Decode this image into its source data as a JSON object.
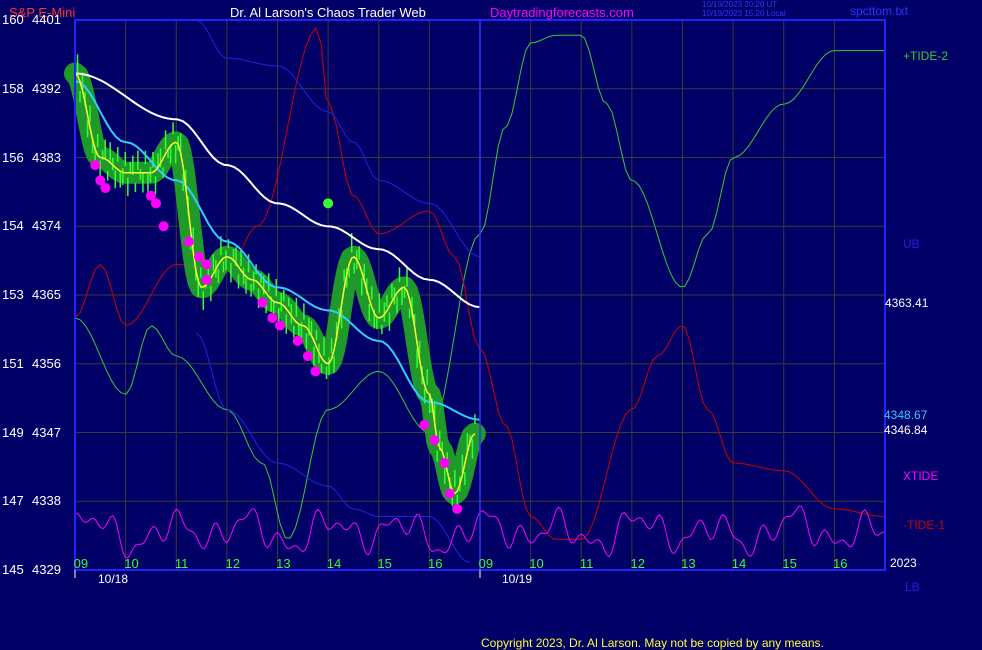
{
  "header": {
    "instrument": "S&P E-Mini",
    "title": "Dr. Al Larson's Chaos Trader Web",
    "site": "Daytradingforecasts.com",
    "stamp_ut": "10/19/2023 20:20 UT",
    "stamp_local": "10/19/2023 15:20 Local",
    "filename": "spcttom.txt"
  },
  "colors": {
    "background": "#000066",
    "grid": "#3a3a3a",
    "frame": "#2222ff",
    "price": "#ffff33",
    "price_bar": "#33ff33",
    "halo": "#22aa22",
    "dot": "#ff00ff",
    "ma_long": "#ffffff",
    "ma_short": "#33ccff",
    "upper_band": "#2222dd",
    "tide_2": "#33cc33",
    "tide_1": "#cc0000",
    "xtide": "#ff00ff",
    "forecast_line": "#3333ff",
    "left_label_text": "#ffffff",
    "hour_label": "#33ff33",
    "copyright_text": "#ffff33"
  },
  "left_axis": [
    {
      "deg": "160",
      "price": "4401"
    },
    {
      "deg": "158",
      "price": "4392"
    },
    {
      "deg": "156",
      "price": "4383"
    },
    {
      "deg": "154",
      "price": "4374"
    },
    {
      "deg": "153",
      "price": "4365"
    },
    {
      "deg": "151",
      "price": "4356"
    },
    {
      "deg": "149",
      "price": "4347"
    },
    {
      "deg": "147",
      "price": "4338"
    },
    {
      "deg": "145",
      "price": "4329"
    }
  ],
  "hour_labels": [
    "09",
    "10",
    "11",
    "12",
    "13",
    "14",
    "15",
    "16",
    "09",
    "10",
    "11",
    "12",
    "13",
    "14",
    "15",
    "16"
  ],
  "date_labels": [
    "10/18",
    "10/19"
  ],
  "year_label": "2023",
  "right_labels": {
    "tide_2": "+TIDE-2",
    "ub": "UB",
    "last_ma_long": "4363.41",
    "last_ma_short": "4348.67",
    "last_price": "4346.84",
    "xtide": "XTIDE",
    "tide_1": "-TIDE-1",
    "lb": "LB"
  },
  "copyright": "Copyright 2023, Dr. Al Larson. May not be copied by any means.",
  "chart_data": {
    "type": "line",
    "title": "S&P E-Mini",
    "y_price_range": [
      4329,
      4401
    ],
    "x_days": [
      "10/18",
      "10/19"
    ],
    "session_hours": [
      "09",
      "10",
      "11",
      "12",
      "13",
      "14",
      "15",
      "16"
    ],
    "series": [
      {
        "name": "price",
        "x": [
          0,
          0.5,
          1,
          1.5,
          2,
          2.5,
          3,
          3.5,
          4,
          4.5,
          5,
          5.5,
          6,
          6.5,
          7,
          7.2,
          7.5,
          7.9
        ],
        "y": [
          4394,
          4383,
          4381,
          4381,
          4385,
          4366,
          4370,
          4367,
          4364,
          4361,
          4356,
          4370,
          4362,
          4366,
          4352,
          4345,
          4339,
          4346.84
        ]
      },
      {
        "name": "4363.41",
        "x": [
          0,
          2,
          3,
          4,
          5,
          6,
          7,
          8
        ],
        "y": [
          4394,
          4388,
          4382,
          4377,
          4374,
          4371,
          4367,
          4363.41
        ]
      },
      {
        "name": "4348.67",
        "x": [
          0,
          1,
          2,
          3,
          4,
          5,
          6,
          7,
          8
        ],
        "y": [
          4393,
          4385,
          4380,
          4372,
          4366,
          4363,
          4359,
          4351,
          4348.67
        ]
      },
      {
        "name": "+TIDE-2",
        "x": [
          8,
          8.5,
          9,
          9.5,
          10,
          10.5,
          11,
          12,
          12.5,
          13,
          14,
          15,
          16
        ],
        "y": [
          4373,
          4387,
          4398,
          4399,
          4399,
          4390,
          4380,
          4366,
          4373,
          4383,
          4390,
          4397,
          4397
        ]
      },
      {
        "name": "-TIDE-1",
        "x": [
          8,
          8.5,
          9,
          9.5,
          10,
          11,
          11.5,
          12,
          12.5,
          13,
          14,
          15,
          16
        ],
        "y": [
          4358,
          4348,
          4336,
          4333,
          4333,
          4350,
          4357,
          4361,
          4350,
          4343,
          4342,
          4337,
          4336
        ]
      }
    ]
  }
}
